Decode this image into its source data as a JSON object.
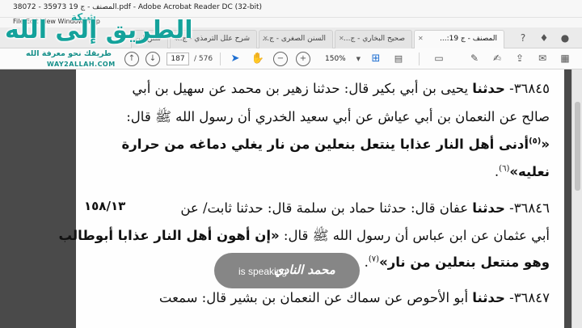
{
  "window": {
    "title": "38072 - 35973 المصنف - ج 19.pdf - Adobe Acrobat Reader DC (32-bit)",
    "menu": "File  Edit  View  Window  Help"
  },
  "tabs": [
    {
      "label": "سنن ابن"
    },
    {
      "label": "شرح علل الترمذي - ج..."
    },
    {
      "label": "السنن الصغرى - ج..."
    },
    {
      "label": "صحيح البخاري - ج..."
    },
    {
      "label": "المصنف - ج 19:..."
    }
  ],
  "toolbar": {
    "page_current": "187",
    "page_total": "/ 576",
    "zoom": "150%"
  },
  "logo": {
    "line1": "شبكة",
    "line2": "الطريق إلى الله",
    "line3": "طريقك نحو معرفة الله",
    "line4": "WAY2ALLAH.COM"
  },
  "document": {
    "lines": [
      {
        "html": "٣٦٨٤٥- <b>حدثنا</b> يحيى بن أبي بكير قال: حدثنا زهير بن محمد عن سهيل بن أبي"
      },
      {
        "html": "صالح عن النعمان بن أبي عياش عن أبي سعيد الخدري أن رسول الله ﷺ قال:"
      },
      {
        "html": "<b>«<span class=\"fn\">(٥)</span>أدنى أهل النار عذابا ينتعل بنعلين من نار يغلي دماغه من حرارة</b>"
      },
      {
        "html": "<b>نعليه»</b><span class=\"fn\">(٦)</span>."
      },
      {
        "html": "٣٦٨٤٦- <b>حدثنا</b> عفان قال: حدثنا حماد بن سلمة قال: حدثنا ثابت/ عن"
      },
      {
        "html": "أبي عثمان عن ابن عباس أن رسول الله ﷺ قال: <b>«إن أهون أهل النار عذابا أبوطالب</b>"
      },
      {
        "html": "<b>وهو منتعل بنعلين من نار»</b><span class=\"fn\">(٧)</span>."
      },
      {
        "html": "٣٦٨٤٧- <b>حدثنا</b> أبو الأحوص عن سماك عن النعمان بن بشير قال: سمعت"
      }
    ],
    "margin_ref": "١٥٨/١٣"
  },
  "speaking": {
    "name": "محمد النادي",
    "text": "is speaking"
  }
}
